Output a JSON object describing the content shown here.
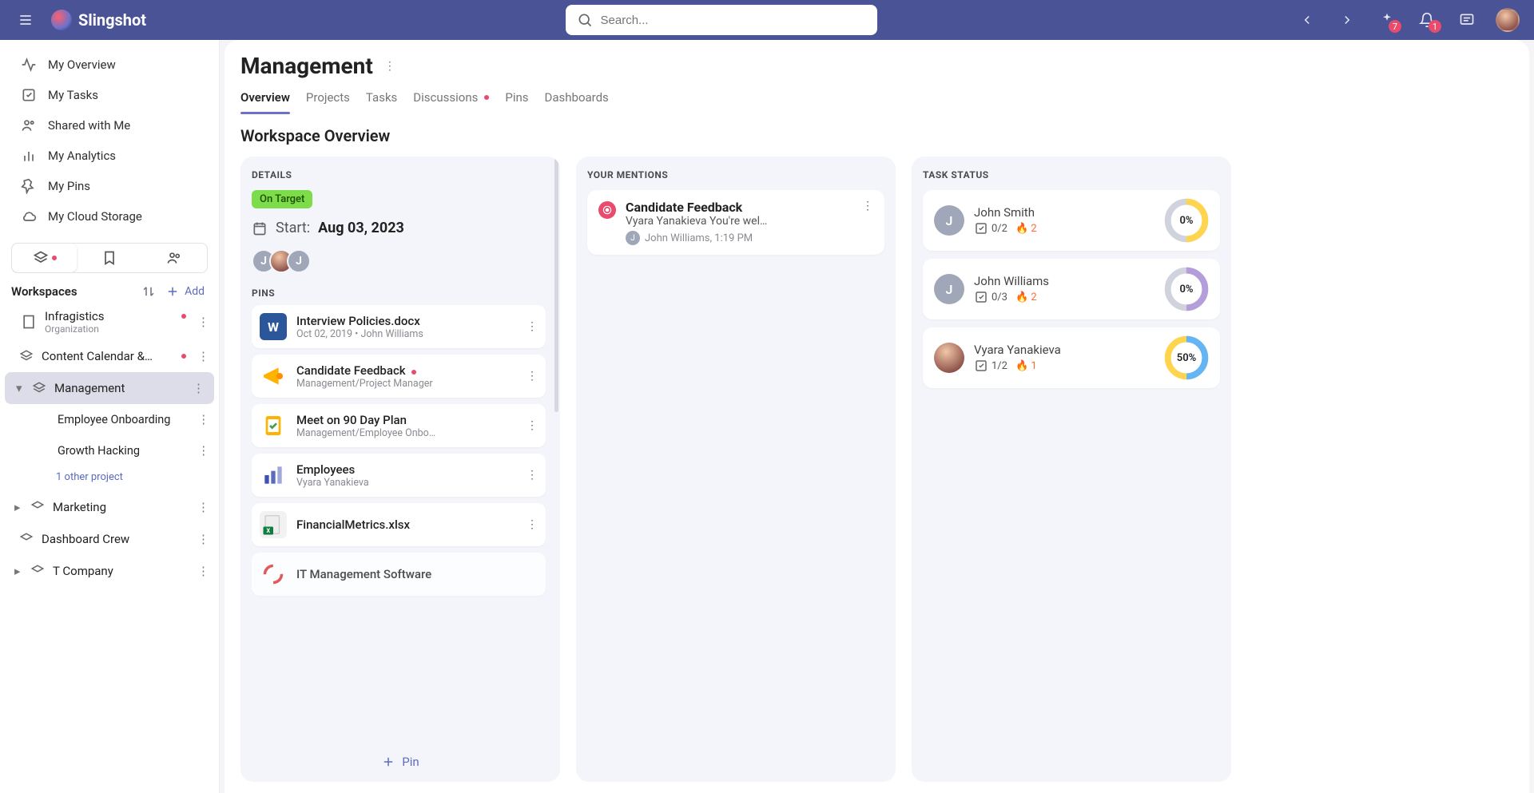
{
  "app": {
    "name": "Slingshot"
  },
  "search": {
    "placeholder": "Search..."
  },
  "badges": {
    "sparkle": "7",
    "bell": "1"
  },
  "sidebar": {
    "items": [
      {
        "label": "My Overview"
      },
      {
        "label": "My Tasks"
      },
      {
        "label": "Shared with Me"
      },
      {
        "label": "My Analytics"
      },
      {
        "label": "My Pins"
      },
      {
        "label": "My Cloud Storage"
      }
    ],
    "workspaces_label": "Workspaces",
    "add_label": "Add",
    "tree": {
      "org": {
        "name": "Infragistics",
        "subtitle": "Organization"
      },
      "items": [
        {
          "label": "Content Calendar &…",
          "hasDot": true
        },
        {
          "label": "Management",
          "active": true,
          "children": [
            {
              "label": "Employee Onboarding"
            },
            {
              "label": "Growth Hacking"
            }
          ],
          "other_projects": "1 other project"
        },
        {
          "label": "Marketing"
        },
        {
          "label": "Dashboard Crew"
        },
        {
          "label": "T Company"
        }
      ]
    }
  },
  "page": {
    "title": "Management",
    "tabs": [
      {
        "label": "Overview",
        "active": true
      },
      {
        "label": "Projects"
      },
      {
        "label": "Tasks"
      },
      {
        "label": "Discussions",
        "dot": true
      },
      {
        "label": "Pins"
      },
      {
        "label": "Dashboards"
      }
    ],
    "section": "Workspace Overview"
  },
  "details": {
    "head": "DETAILS",
    "status": "On Target",
    "start_label": "Start:",
    "start_date": "Aug 03, 2023",
    "pins_head": "PINS",
    "pins": [
      {
        "title": "Interview Policies.docx",
        "sub": "Oct 02, 2019  •  John Williams",
        "type": "word"
      },
      {
        "title": "Candidate Feedback",
        "sub": "Management/Project Manager",
        "type": "mega",
        "dot": true
      },
      {
        "title": "Meet on 90 Day Plan",
        "sub": "Management/Employee Onbo…",
        "type": "board"
      },
      {
        "title": "Employees",
        "sub": "Vyara Yanakieva",
        "type": "chart"
      },
      {
        "title": "FinancialMetrics.xlsx",
        "sub": "",
        "type": "xls"
      },
      {
        "title": "IT Management Software",
        "sub": "",
        "type": "generic"
      }
    ],
    "pin_action": "Pin"
  },
  "mentions": {
    "head": "YOUR MENTIONS",
    "item": {
      "title": "Candidate Feedback",
      "subtitle": "Vyara Yanakieva You're wel…",
      "by": "John Williams, 1:19 PM"
    }
  },
  "task_status": {
    "head": "TASK STATUS",
    "rows": [
      {
        "name": "John Smith",
        "done": "0/2",
        "fire": "2",
        "pct": "0%",
        "avatar": "J",
        "colors": [
          "#ffd54f",
          "#d0d3dd"
        ]
      },
      {
        "name": "John Williams",
        "done": "0/3",
        "fire": "2",
        "pct": "0%",
        "avatar": "J",
        "colors": [
          "#b39ddb",
          "#d0d3dd"
        ]
      },
      {
        "name": "Vyara Yanakieva",
        "done": "1/2",
        "fire": "1",
        "pct": "50%",
        "avatar": "photo",
        "colors": [
          "#64b5f6",
          "#ffd54f"
        ]
      }
    ]
  }
}
